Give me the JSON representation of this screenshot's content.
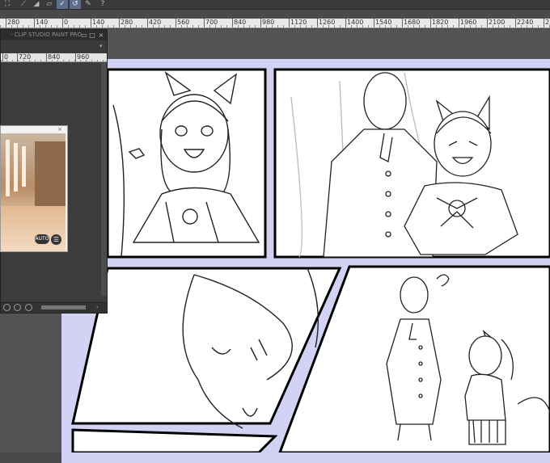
{
  "toolbar": {
    "icons": [
      "frame-icon",
      "snap-icon",
      "snap-grid-icon",
      "snap-special-icon",
      "snap-ruler-icon",
      "pen-icon",
      "help-icon"
    ]
  },
  "ruler": {
    "labels": [
      "280",
      "140",
      "0",
      "140",
      "280",
      "420",
      "560",
      "700",
      "840",
      "980",
      "1120",
      "1260",
      "1400",
      "1540",
      "1680",
      "1820",
      "1960",
      "2100",
      "2240",
      "238"
    ]
  },
  "navigator": {
    "title": "- CLIP STUDIO PAINT PRO",
    "ruler_labels": [
      "0",
      "720",
      "840",
      "960"
    ],
    "auto_label": "AUTO",
    "menu_glyph": "☰",
    "close_glyph": "×"
  },
  "colors": {
    "canvas_bg": "#545454",
    "panel_border_blue": "#d2d2f4",
    "toolbar_active": "#5d6f8c"
  }
}
